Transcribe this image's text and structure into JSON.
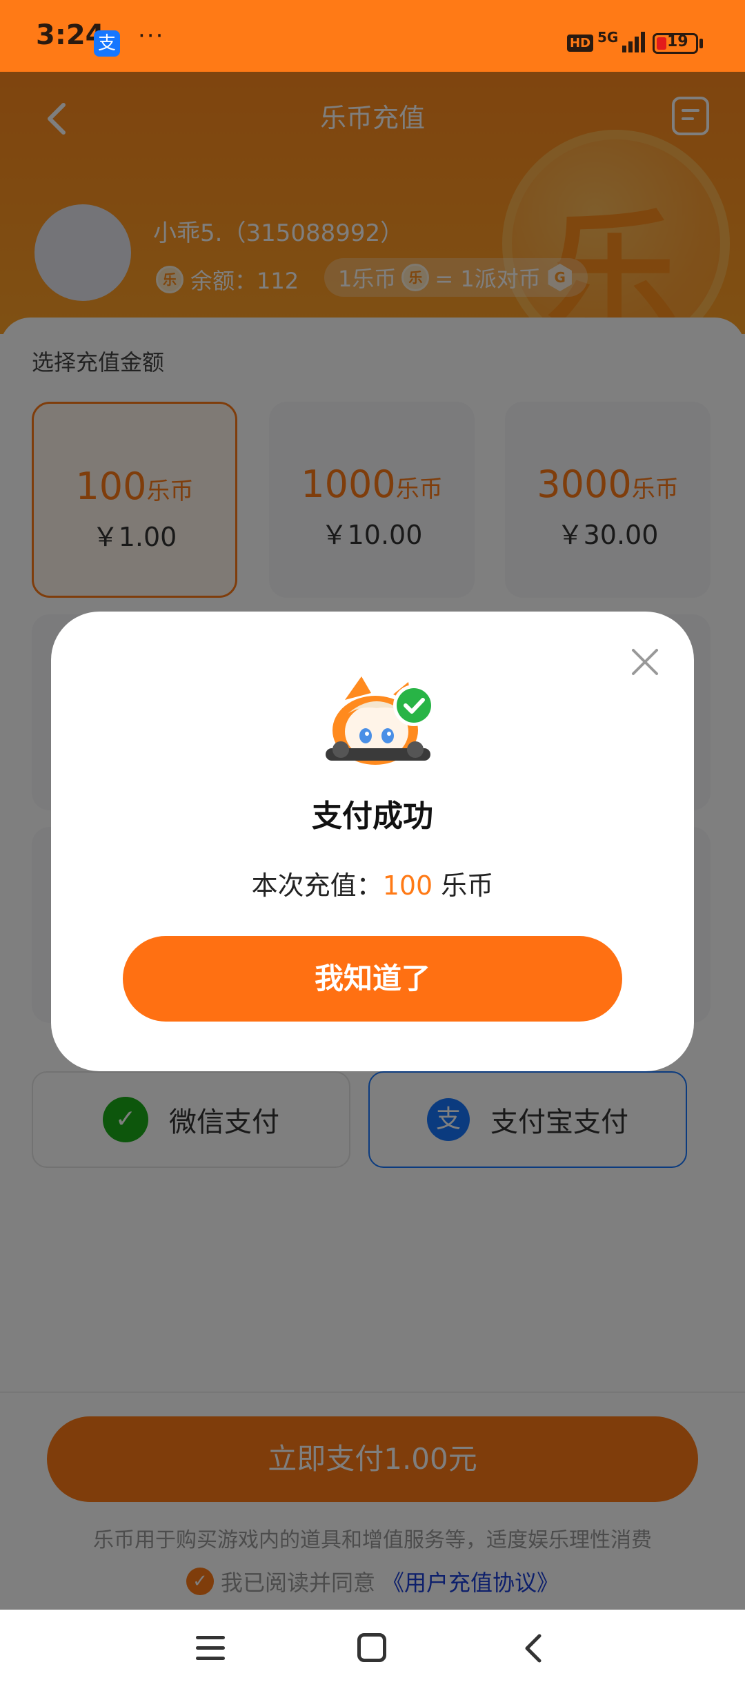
{
  "status_bar": {
    "time": "3:24",
    "alipay_glyph": "支",
    "dots": "···",
    "hd": "HD",
    "network": "5G",
    "battery": "19"
  },
  "header": {
    "title": "乐币充值",
    "big_coin_char": "乐"
  },
  "user": {
    "name": "小乖5.（315088992）",
    "coin_glyph": "乐",
    "balance_label": "余额：112",
    "rate_left": "1乐币",
    "rate_right": "= 1派对币",
    "party_glyph": "G"
  },
  "recharge": {
    "section_label": "选择充值金额",
    "packages": [
      {
        "amount": "100",
        "unit": "乐币",
        "price": "￥1.00"
      },
      {
        "amount": "1000",
        "unit": "乐币",
        "price": "￥10.00"
      },
      {
        "amount": "3000",
        "unit": "乐币",
        "price": "￥30.00"
      }
    ]
  },
  "payment": {
    "wechat_label": "微信支付",
    "wechat_glyph": "✓",
    "alipay_label": "支付宝支付",
    "alipay_glyph": "支"
  },
  "pay_button": "立即支付1.00元",
  "disclaimer": "乐币用于购买游戏内的道具和增值服务等，适度娱乐理性消费",
  "agreement": {
    "check_glyph": "✓",
    "text": "我已阅读并同意",
    "link": "《用户充值协议》"
  },
  "modal": {
    "title": "支付成功",
    "msg_prefix": "本次充值：",
    "msg_amount": "100",
    "msg_suffix": " 乐币",
    "ok_button": "我知道了"
  },
  "colors": {
    "accent": "#ff7a16",
    "alipay_blue": "#1677ff",
    "wechat_green": "#1aad19",
    "link_blue": "#1a3fd6"
  }
}
